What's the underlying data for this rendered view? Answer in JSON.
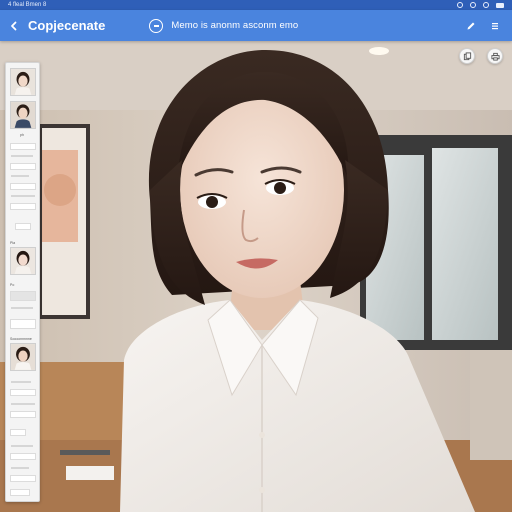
{
  "status_bar": {
    "left_text": "4 fleal Bmen 8"
  },
  "app_bar": {
    "title": "Copjecenate",
    "subtitle": "Memo is anonm asconm emo",
    "background": "#4a84de"
  },
  "icons": {
    "back": "back-arrow-icon",
    "mode": "mode-icon",
    "edit": "pencil-icon",
    "menu": "menu-icon",
    "copy": "copy-icon",
    "print": "print-icon"
  },
  "side_panel": {
    "labels": [
      "ph",
      "Pla",
      "Po",
      "Soooonnnnne"
    ]
  }
}
